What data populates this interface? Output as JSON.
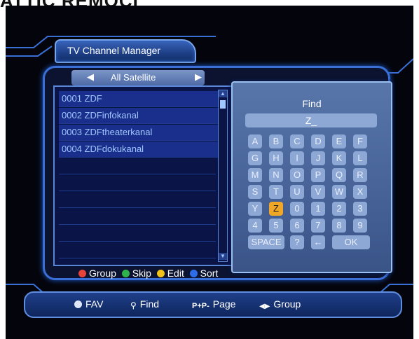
{
  "header_cut_text": "ATTIC REMOCI",
  "window": {
    "title": "TV Channel Manager"
  },
  "satellite": {
    "label": "All Satellite"
  },
  "channels": [
    {
      "label": "0001 ZDF"
    },
    {
      "label": "0002 ZDFinfokanal"
    },
    {
      "label": "0003 ZDFtheaterkanal"
    },
    {
      "label": "0004 ZDFdokukanal"
    }
  ],
  "find": {
    "title": "Find",
    "query": "Z_",
    "keys": [
      "A",
      "B",
      "C",
      "D",
      "E",
      "F",
      "G",
      "H",
      "I",
      "J",
      "K",
      "L",
      "M",
      "N",
      "O",
      "P",
      "Q",
      "R",
      "S",
      "T",
      "U",
      "V",
      "W",
      "X",
      "Y",
      "Z",
      "0",
      "1",
      "2",
      "3",
      "4",
      "5",
      "6",
      "7",
      "8",
      "9"
    ],
    "space_label": "SPACE",
    "question_label": "?",
    "backspace_label": "←",
    "ok_label": "OK",
    "selected_key": "Z"
  },
  "legend": {
    "group": "Group",
    "skip": "Skip",
    "edit": "Edit",
    "sort": "Sort",
    "colors": {
      "red": "#e8433a",
      "green": "#2fb44c",
      "yellow": "#f1c21a",
      "blue": "#2f6ce8"
    }
  },
  "bottom_bar": {
    "fav": "FAV",
    "find": "Find",
    "page_icon": "P+P-",
    "page": "Page",
    "group_icon": "◆▶",
    "group": "Group"
  }
}
